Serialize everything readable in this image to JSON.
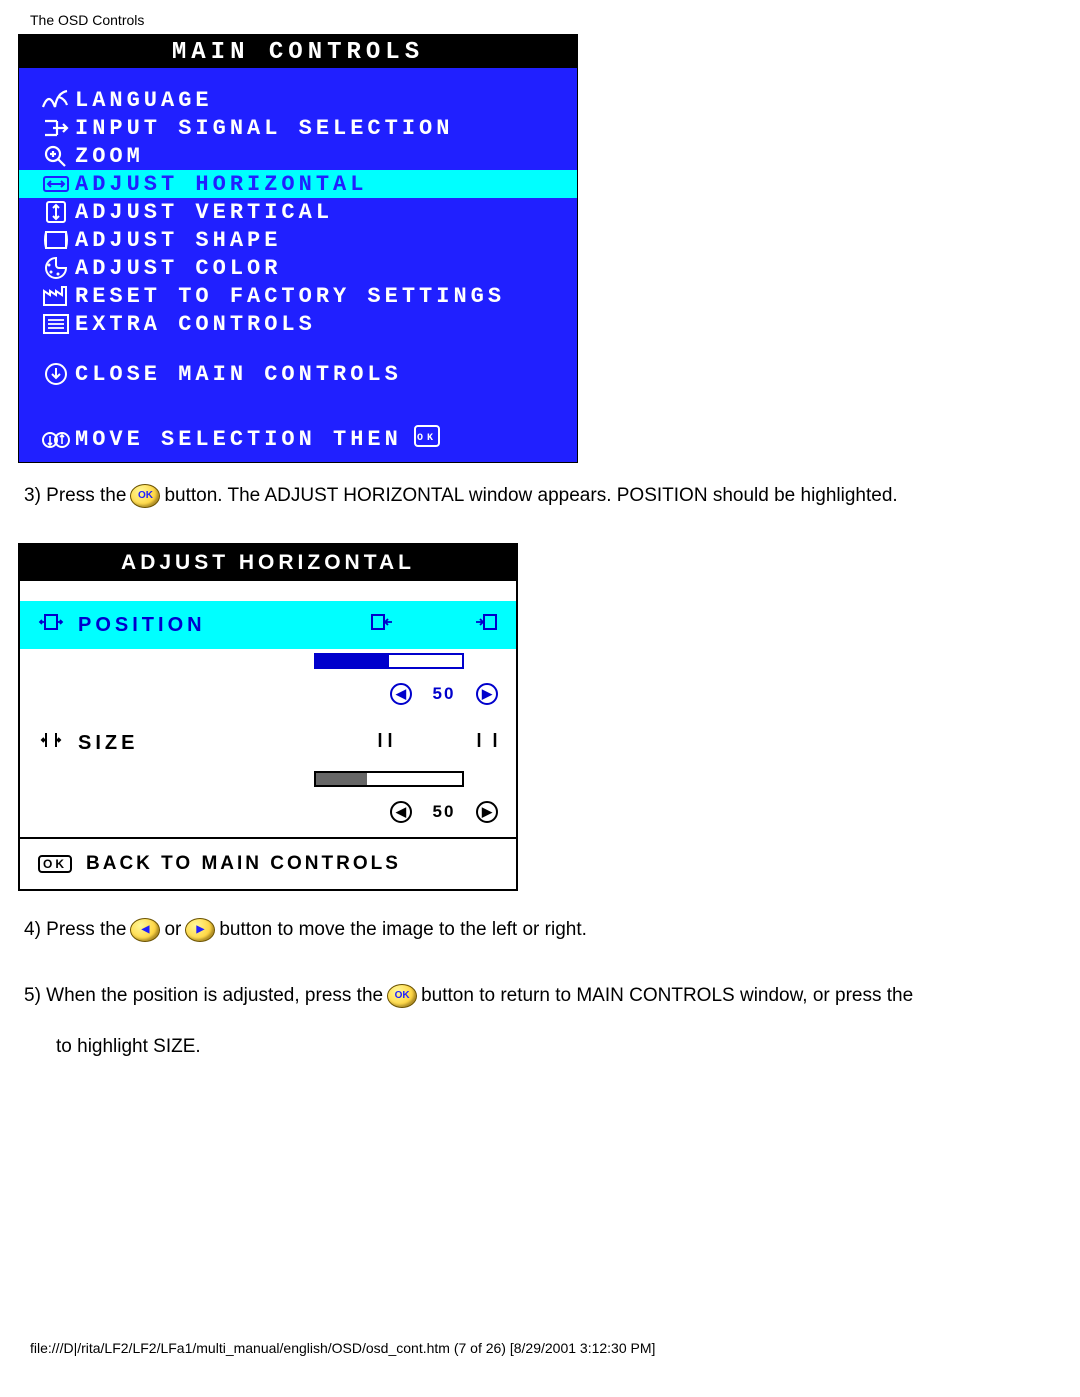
{
  "header": "The OSD Controls",
  "main_osd": {
    "title": "MAIN CONTROLS",
    "items": [
      {
        "label": "LANGUAGE",
        "selected": false
      },
      {
        "label": "INPUT SIGNAL SELECTION",
        "selected": false
      },
      {
        "label": "ZOOM",
        "selected": false
      },
      {
        "label": "ADJUST HORIZONTAL",
        "selected": true
      },
      {
        "label": "ADJUST VERTICAL",
        "selected": false
      },
      {
        "label": "ADJUST SHAPE",
        "selected": false
      },
      {
        "label": "ADJUST COLOR",
        "selected": false
      },
      {
        "label": "RESET TO FACTORY SETTINGS",
        "selected": false
      },
      {
        "label": "EXTRA CONTROLS",
        "selected": false
      }
    ],
    "close": "CLOSE MAIN CONTROLS",
    "footer": "MOVE SELECTION THEN"
  },
  "step3": {
    "a": "3) Press the",
    "b": "button. The ADJUST HORIZONTAL window appears. POSITION should be highlighted."
  },
  "adjust_panel": {
    "title": "ADJUST HORIZONTAL",
    "position_label": "POSITION",
    "position_value": "50",
    "position_fill": 50,
    "size_label": "SIZE",
    "size_value": "50",
    "size_fill": 35,
    "back": "BACK TO MAIN CONTROLS"
  },
  "step4": {
    "a": "4) Press the",
    "b": "or",
    "c": "button to move the image to the left or right."
  },
  "step5": {
    "a": "5) When the position is adjusted, press the",
    "b": "button to return to MAIN CONTROLS window, or press the",
    "c": "to highlight SIZE."
  },
  "footer_path": "file:///D|/rita/LF2/LF2/LFa1/multi_manual/english/OSD/osd_cont.htm (7 of 26) [8/29/2001 3:12:30 PM]"
}
